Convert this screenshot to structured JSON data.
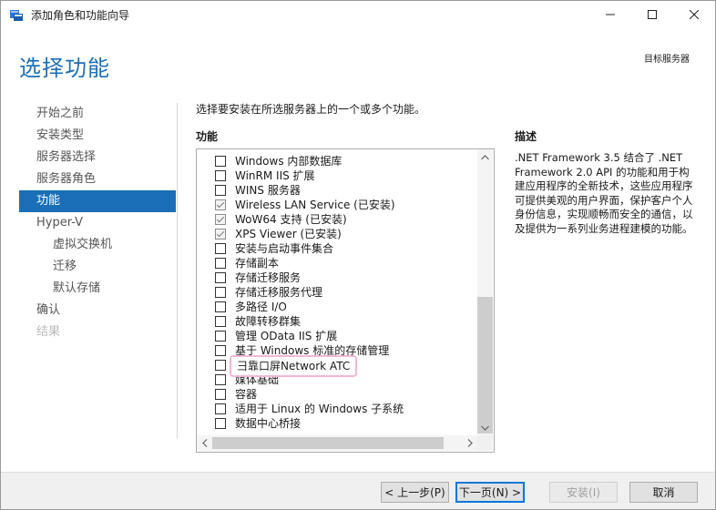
{
  "window": {
    "title": "添加角色和功能向导"
  },
  "header": {
    "page_title": "选择功能",
    "target_server": "目标服务器"
  },
  "nav": {
    "items": [
      {
        "label": "开始之前",
        "state": "normal",
        "level": 0
      },
      {
        "label": "安装类型",
        "state": "normal",
        "level": 0
      },
      {
        "label": "服务器选择",
        "state": "normal",
        "level": 0
      },
      {
        "label": "服务器角色",
        "state": "normal",
        "level": 0
      },
      {
        "label": "功能",
        "state": "active",
        "level": 0
      },
      {
        "label": "Hyper-V",
        "state": "normal",
        "level": 0
      },
      {
        "label": "虚拟交换机",
        "state": "normal",
        "level": 1
      },
      {
        "label": "迁移",
        "state": "normal",
        "level": 1
      },
      {
        "label": "默认存储",
        "state": "normal",
        "level": 1
      },
      {
        "label": "确认",
        "state": "normal",
        "level": 0
      },
      {
        "label": "结果",
        "state": "disabled",
        "level": 0
      }
    ]
  },
  "main": {
    "instruction": "选择要安装在所选服务器上的一个或多个功能。",
    "features_label": "功能",
    "features": [
      {
        "label": "Windows 内部数据库",
        "checked": false
      },
      {
        "label": "WinRM IIS 扩展",
        "checked": false
      },
      {
        "label": "WINS 服务器",
        "checked": false
      },
      {
        "label": "Wireless LAN Service (已安装)",
        "checked": true
      },
      {
        "label": "WoW64 支持 (已安装)",
        "checked": true
      },
      {
        "label": "XPS Viewer (已安装)",
        "checked": true
      },
      {
        "label": "安装与启动事件集合",
        "checked": false
      },
      {
        "label": "存储副本",
        "checked": false
      },
      {
        "label": "存储迁移服务",
        "checked": false
      },
      {
        "label": "存储迁移服务代理",
        "checked": false
      },
      {
        "label": "多路径 I/O",
        "checked": false
      },
      {
        "label": "故障转移群集",
        "checked": false
      },
      {
        "label": "管理 OData IIS 扩展",
        "checked": false
      },
      {
        "label": "基于 Windows 标准的存储管理",
        "checked": false
      },
      {
        "label": "⺕靠口屏Network ATC",
        "checked": false,
        "highlight": true
      },
      {
        "label": "媒体基础",
        "checked": false
      },
      {
        "label": "容器",
        "checked": false
      },
      {
        "label": "适用于 Linux 的 Windows 子系统",
        "checked": false
      },
      {
        "label": "数据中心桥接",
        "checked": false
      }
    ]
  },
  "description": {
    "label": "描述",
    "text": ".NET Framework 3.5 结合了 .NET Framework 2.0 API 的功能和用于构建应用程序的全新技术，这些应用程序可提供美观的用户界面，保护客户个人身份信息，实现顺畅而安全的通信，以及提供为一系列业务进程建模的功能。"
  },
  "footer": {
    "prev_label": "< 上一步(P)",
    "next_label": "下一页(N) >",
    "install_label": "安装(I)",
    "cancel_label": "取消"
  },
  "colors": {
    "accent": "#1a6fb8",
    "title_blue": "#1f6fb3",
    "highlight_border": "#f2b6d6"
  }
}
